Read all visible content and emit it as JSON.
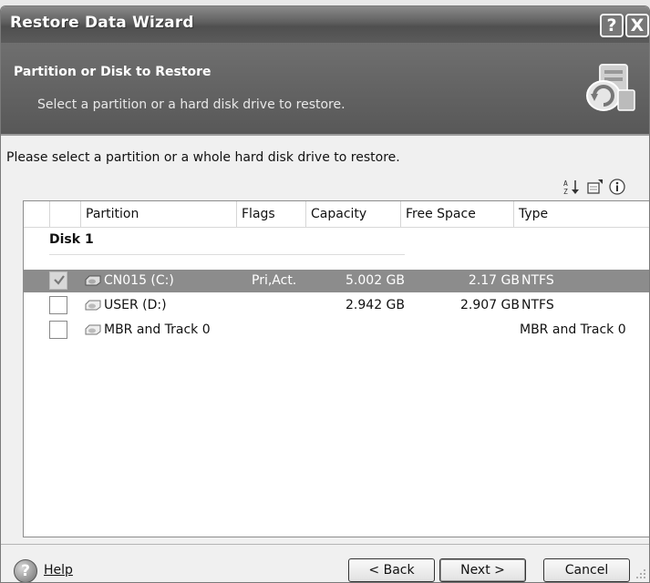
{
  "window": {
    "title": "Restore Data Wizard",
    "help_glyph": "?",
    "close_glyph": "X"
  },
  "header": {
    "title": "Partition or Disk to Restore",
    "subtitle": "Select a partition or a hard disk drive to restore.",
    "icon": "restore-wizard-icon"
  },
  "instruction": "Please select a partition or a whole hard disk drive to restore.",
  "toolbar": {
    "icons": [
      "sort-icon",
      "properties-icon",
      "info-icon"
    ]
  },
  "table": {
    "columns": [
      "Partition",
      "Flags",
      "Capacity",
      "Free Space",
      "Type"
    ],
    "group": "Disk 1",
    "rows": [
      {
        "checked": true,
        "partition": "CN015 (C:)",
        "flags": "Pri,Act.",
        "capacity": "5.002 GB",
        "free_space": "2.17 GB",
        "type": "NTFS",
        "selected": true
      },
      {
        "checked": false,
        "partition": "USER (D:)",
        "flags": "",
        "capacity": "2.942 GB",
        "free_space": "2.907 GB",
        "type": "NTFS",
        "selected": false
      },
      {
        "checked": false,
        "partition": "MBR and Track 0",
        "flags": "",
        "capacity": "",
        "free_space": "",
        "type": "MBR and Track 0",
        "selected": false
      }
    ]
  },
  "footer": {
    "help_label": "Help",
    "back_label": "< Back",
    "next_label": "Next >",
    "cancel_label": "Cancel"
  }
}
